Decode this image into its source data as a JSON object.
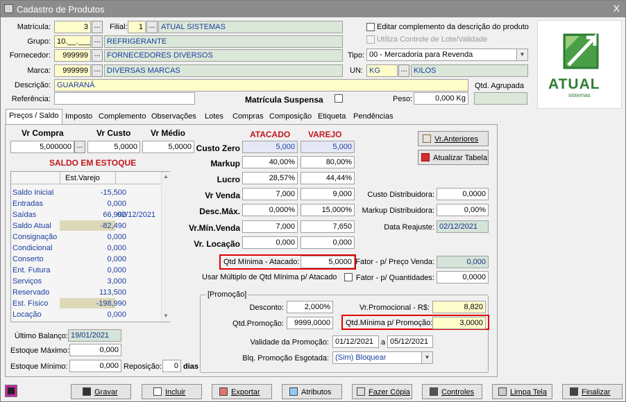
{
  "window": {
    "title": "Cadastro de Produtos",
    "close": "X"
  },
  "header": {
    "matricula_label": "Matrícula:",
    "matricula": "3",
    "filial_label": "Filial:",
    "filial_code": "1",
    "filial_name": "ATUAL SISTEMAS",
    "grupo_label": "Grupo:",
    "grupo_code": "10.__.___",
    "grupo_name": "REFRIGERANTE",
    "fornecedor_label": "Fornecedor:",
    "fornecedor_code": "999999",
    "fornecedor_name": "FORNECEDORES DIVERSOS",
    "marca_label": "Marca:",
    "marca_code": "999999",
    "marca_name": "DIVERSAS MARCAS",
    "descricao_label": "Descrição:",
    "descricao": "GUARANÁ",
    "referencia_label": "Referência:",
    "referencia": "",
    "matricula_suspensa_label": "Matrícula Suspensa",
    "peso_label": "Peso:",
    "peso": "0,000 Kg",
    "qtd_agrupada_label": "Qtd. Agrupada",
    "qtd_agrupada": "",
    "editar_complemento_label": "Editar complemento da descrição do produto",
    "controle_lote_label": "Utiliza Controle de Lote/Validade",
    "tipo_label": "Tipo:",
    "tipo": "00 - Mercadoria para Revenda",
    "un_label": "UN:",
    "un_code": "KG",
    "un_name": "KILOS",
    "dots": "...",
    "logo_text": "ATUAL",
    "logo_sub": "sistemas"
  },
  "tabs": [
    "Preços / Saldo",
    "Imposto",
    "Complemento",
    "Observações",
    "Lotes",
    "Compras",
    "Composição",
    "Etiqueta",
    "Pendências"
  ],
  "precos": {
    "vr_compra_label": "Vr Compra",
    "vr_compra": "5,000000",
    "vr_custo_label": "Vr Custo",
    "vr_custo": "5,0000",
    "vr_medio_label": "Vr Médio",
    "vr_medio": "5,0000",
    "atacado_header": "ATACADO",
    "varejo_header": "VAREJO",
    "rows": [
      {
        "label": "Custo Zero",
        "atacado": "5,000",
        "varejo": "5,000"
      },
      {
        "label": "Markup",
        "atacado": "40,00%",
        "varejo": "80,00%"
      },
      {
        "label": "Lucro",
        "atacado": "28,57%",
        "varejo": "44,44%"
      },
      {
        "label": "Vr Venda",
        "atacado": "7,000",
        "varejo": "9,000"
      },
      {
        "label": "Desc.Máx.",
        "atacado": "0,000%",
        "varejo": "15,000%"
      },
      {
        "label": "Vr.Mín.Venda",
        "atacado": "7,000",
        "varejo": "7,650"
      },
      {
        "label": "Vr. Locação",
        "atacado": "0,000",
        "varejo": "0,000"
      }
    ],
    "vr_anteriores": "Vr.Anteriores",
    "atualizar_tabela": "Atualizar Tabela",
    "custo_distribuidora_label": "Custo Distribuidora:",
    "custo_distribuidora": "0,0000",
    "markup_distribuidora_label": "Markup Distribuidora:",
    "markup_distribuidora": "0,00%",
    "data_reajuste_label": "Data Reajuste:",
    "data_reajuste": "02/12/2021",
    "qtd_minima_atacado_label": "Qtd Mínima - Atacado:",
    "qtd_minima_atacado": "5,0000",
    "usar_multiplo_label": "Usar Múltiplo de Qtd Mínima p/ Atacado",
    "fator_preco_label": "Fator - p/ Preço Venda:",
    "fator_preco": "0,000",
    "fator_qtd_label": "Fator - p/ Quantidades:",
    "fator_qtd": "0,0000"
  },
  "saldo": {
    "title": "SALDO EM ESTOQUE",
    "col_header": "Est.Varejo",
    "rows": [
      {
        "label": "Saldo Inicial",
        "value": "-15,500",
        "date": ""
      },
      {
        "label": "Entradas",
        "value": "0,000",
        "date": ""
      },
      {
        "label": "Saídas",
        "value": "66,990",
        "date": "02/12/2021"
      },
      {
        "label": "Saldo Atual",
        "value": "-82,490",
        "date": ""
      },
      {
        "label": "Consignação",
        "value": "0,000",
        "date": ""
      },
      {
        "label": "Condicional",
        "value": "0,000",
        "date": ""
      },
      {
        "label": "Conserto",
        "value": "0,000",
        "date": ""
      },
      {
        "label": "Ent. Futura",
        "value": "0,000",
        "date": ""
      },
      {
        "label": "Serviços",
        "value": "3,000",
        "date": ""
      },
      {
        "label": "Reservado",
        "value": "113,500",
        "date": ""
      },
      {
        "label": "Est. Físico",
        "value": "-198,990",
        "date": ""
      },
      {
        "label": "Locação",
        "value": "0,000",
        "date": ""
      }
    ],
    "ultimo_balanco_label": "Último Balanço:",
    "ultimo_balanco": "19/01/2021",
    "estoque_maximo_label": "Estoque Máximo:",
    "estoque_maximo": "0,000",
    "estoque_minimo_label": "Estoque Mínimo:",
    "estoque_minimo": "0,000",
    "reposicao_label": "Reposição:",
    "reposicao": "0",
    "dias_label": "dias"
  },
  "promocao": {
    "legend": "[Promoção]",
    "desconto_label": "Desconto:",
    "desconto": "2,000%",
    "vr_promocional_label": "Vr.Promocional - R$:",
    "vr_promocional": "8,820",
    "qtd_promocao_label": "Qtd.Promoção:",
    "qtd_promocao": "9999,0000",
    "qtd_minima_promocao_label": "Qtd.Mínima p/ Promoção:",
    "qtd_minima_promocao": "3,0000",
    "validade_label": "Validade da Promoção:",
    "validade_de": "01/12/2021",
    "validade_a_label": "a",
    "validade_ate": "05/12/2021",
    "blq_label": "Blq. Promoção Esgotada:",
    "blq": "(Sim) Bloquear"
  },
  "buttons": {
    "gravar": "Gravar",
    "incluir": "Incluir",
    "exportar": "Exportar",
    "atributos": "Atributos",
    "fazer_copia": "Fazer Cópia",
    "controles": "Controles",
    "limpa_tela": "Limpa Tela",
    "finalizar": "Finalizar"
  },
  "colors": {
    "title_bar": "#8c8c8c",
    "highlight_box": "#e00000",
    "header_red": "#c3161c",
    "logo_green": "#2e7d32"
  }
}
